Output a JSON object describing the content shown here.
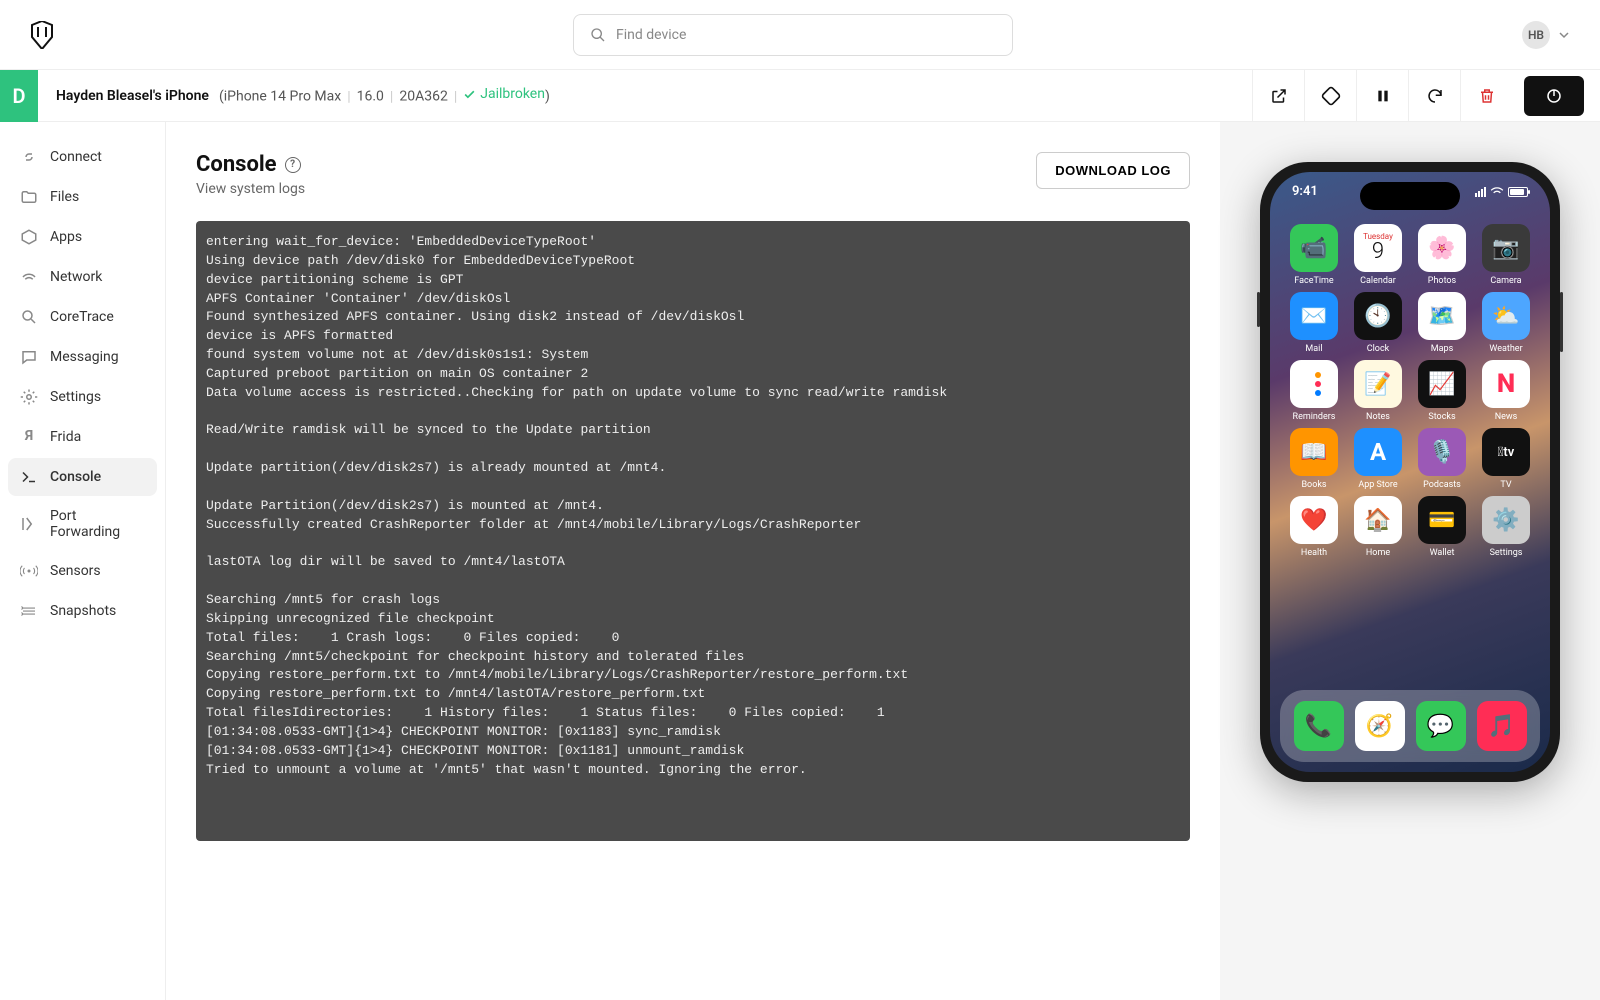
{
  "search": {
    "placeholder": "Find device"
  },
  "user": {
    "initials": "HB"
  },
  "device": {
    "badge": "D",
    "name": "Hayden Bleasel's iPhone",
    "model": "iPhone 14 Pro Max",
    "os": "16.0",
    "build": "20A362",
    "jailbroken": "Jailbroken"
  },
  "sidebar": {
    "items": [
      {
        "label": "Connect"
      },
      {
        "label": "Files"
      },
      {
        "label": "Apps"
      },
      {
        "label": "Network"
      },
      {
        "label": "CoreTrace"
      },
      {
        "label": "Messaging"
      },
      {
        "label": "Settings"
      },
      {
        "label": "Frida"
      },
      {
        "label": "Console"
      },
      {
        "label": "Port Forwarding"
      },
      {
        "label": "Sensors"
      },
      {
        "label": "Snapshots"
      }
    ]
  },
  "console": {
    "title": "Console",
    "subtitle": "View system logs",
    "download_label": "DOWNLOAD LOG",
    "log": "entering wait_for_device: 'EmbeddedDeviceTypeRoot'\nUsing device path /dev/disk0 for EmbeddedDeviceTypeRoot\ndevice partitioning scheme is GPT\nAPFS Container 'Container' /dev/diskOsl\nFound synthesized APFS container. Using disk2 instead of /dev/diskOsl\ndevice is APFS formatted\nfound system volume not at /dev/disk0s1s1: System\nCaptured preboot partition on main OS container 2\nData volume access is restricted..Checking for path on update volume to sync read/write ramdisk\n\nRead/Write ramdisk will be synced to the Update partition\n\nUpdate partition(/dev/disk2s7) is already mounted at /mnt4.\n\nUpdate Partition(/dev/disk2s7) is mounted at /mnt4.\nSuccessfully created CrashReporter folder at /mnt4/mobile/Library/Logs/CrashReporter\n\nlastOTA log dir will be saved to /mnt4/lastOTA\n\nSearching /mnt5 for crash logs\nSkipping unrecognized file checkpoint\nTotal files:    1 Crash logs:    0 Files copied:    0\nSearching /mnt5/checkpoint for checkpoint history and tolerated files\nCopying restore_perform.txt to /mnt4/mobile/Library/Logs/CrashReporter/restore_perform.txt\nCopying restore_perform.txt to /mnt4/lastOTA/restore_perform.txt\nTotal filesIdirectories:    1 History files:    1 Status files:    0 Files copied:    1\n[01:34:08.0533-GMT]{1>4} CHECKPOINT MONITOR: [0x1183] sync_ramdisk\n[01:34:08.0533-GMT]{1>4} CHECKPOINT MONITOR: [0x1181] unmount_ramdisk\nTried to unmount a volume at '/mnt5' that wasn't mounted. Ignoring the error."
  },
  "phone": {
    "time": "9:41",
    "calendar_day": "Tuesday",
    "calendar_date": "9",
    "apps": [
      {
        "name": "FaceTime",
        "bg": "#34c759",
        "glyph": "📹"
      },
      {
        "name": "Calendar",
        "bg": "#ffffff",
        "glyph": ""
      },
      {
        "name": "Photos",
        "bg": "#ffffff",
        "glyph": "🌸"
      },
      {
        "name": "Camera",
        "bg": "#3a3a3a",
        "glyph": "📷"
      },
      {
        "name": "Mail",
        "bg": "#1e90ff",
        "glyph": "✉️"
      },
      {
        "name": "Clock",
        "bg": "#111111",
        "glyph": "🕙"
      },
      {
        "name": "Maps",
        "bg": "#ffffff",
        "glyph": "🗺️"
      },
      {
        "name": "Weather",
        "bg": "#4da6ff",
        "glyph": "⛅"
      },
      {
        "name": "Reminders",
        "bg": "#ffffff",
        "glyph": "≡"
      },
      {
        "name": "Notes",
        "bg": "#fff9e0",
        "glyph": "📝"
      },
      {
        "name": "Stocks",
        "bg": "#111111",
        "glyph": "📈"
      },
      {
        "name": "News",
        "bg": "#ffffff",
        "glyph": "N"
      },
      {
        "name": "Books",
        "bg": "#ff9500",
        "glyph": "📖"
      },
      {
        "name": "App Store",
        "bg": "#1e90ff",
        "glyph": "A"
      },
      {
        "name": "Podcasts",
        "bg": "#9b59b6",
        "glyph": "🎙️"
      },
      {
        "name": "TV",
        "bg": "#111111",
        "glyph": "tv"
      },
      {
        "name": "Health",
        "bg": "#ffffff",
        "glyph": "❤️"
      },
      {
        "name": "Home",
        "bg": "#ffffff",
        "glyph": "🏠"
      },
      {
        "name": "Wallet",
        "bg": "#111111",
        "glyph": "💳"
      },
      {
        "name": "Settings",
        "bg": "#cccccc",
        "glyph": "⚙️"
      }
    ],
    "dock": [
      {
        "name": "Phone",
        "bg": "#34c759",
        "glyph": "📞"
      },
      {
        "name": "Safari",
        "bg": "#ffffff",
        "glyph": "🧭"
      },
      {
        "name": "Messages",
        "bg": "#34c759",
        "glyph": "💬"
      },
      {
        "name": "Music",
        "bg": "#ff2d55",
        "glyph": "🎵"
      }
    ]
  }
}
